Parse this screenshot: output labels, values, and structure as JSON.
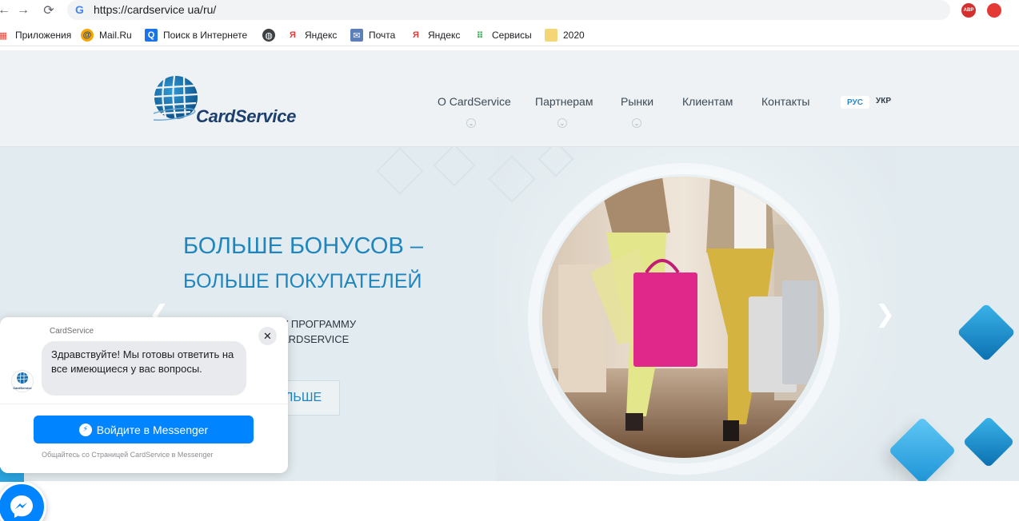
{
  "browser": {
    "url": "https://cardservice ua/ru/",
    "ext_abp": "ABP"
  },
  "bookmarks": [
    {
      "label": "Приложения",
      "icon": "apps-icon"
    },
    {
      "label": "Mail.Ru",
      "icon": "mailru-icon"
    },
    {
      "label": "Поиск в Интернете",
      "icon": "search-icon"
    },
    {
      "label": "",
      "icon": "globe-icon"
    },
    {
      "label": "Яндекс",
      "icon": "yandex-icon"
    },
    {
      "label": "Почта",
      "icon": "mail-icon"
    },
    {
      "label": "Яндекс",
      "icon": "yandex-letter-icon"
    },
    {
      "label": "Сервисы",
      "icon": "grid-icon"
    },
    {
      "label": "2020",
      "icon": "folder-icon"
    }
  ],
  "site": {
    "logo_text": "CardService",
    "menu": [
      {
        "label": "О CardService",
        "has_dropdown": true
      },
      {
        "label": "Партнерам",
        "has_dropdown": true
      },
      {
        "label": "Рынки",
        "has_dropdown": true
      },
      {
        "label": "Клиентам",
        "has_dropdown": false
      },
      {
        "label": "Контакты",
        "has_dropdown": false
      }
    ],
    "lang_active": "РУС",
    "lang_other": "УКР"
  },
  "hero": {
    "headline_1": "БОЛЬШЕ БОНУСОВ –",
    "headline_2": "БОЛЬШЕ ПОКУПАТЕЛЕЙ",
    "sub_1": "У ПРОГРАММУ",
    "sub_2": "ARDSERVICE",
    "button": "ЛЬШЕ"
  },
  "messenger": {
    "page_name": "CardService",
    "greeting": "Здравствуйте! Мы готовы ответить на все имеющиеся у вас вопросы.",
    "avatar_label": "CardService",
    "login_button": "Войдите в Messenger",
    "note": "Общайтесь со Страницей CardService в Messenger",
    "close": "✕"
  },
  "colors": {
    "accent": "#1f86bd",
    "messenger_blue": "#0084ff",
    "deco_blue": "#1a8fd0"
  }
}
